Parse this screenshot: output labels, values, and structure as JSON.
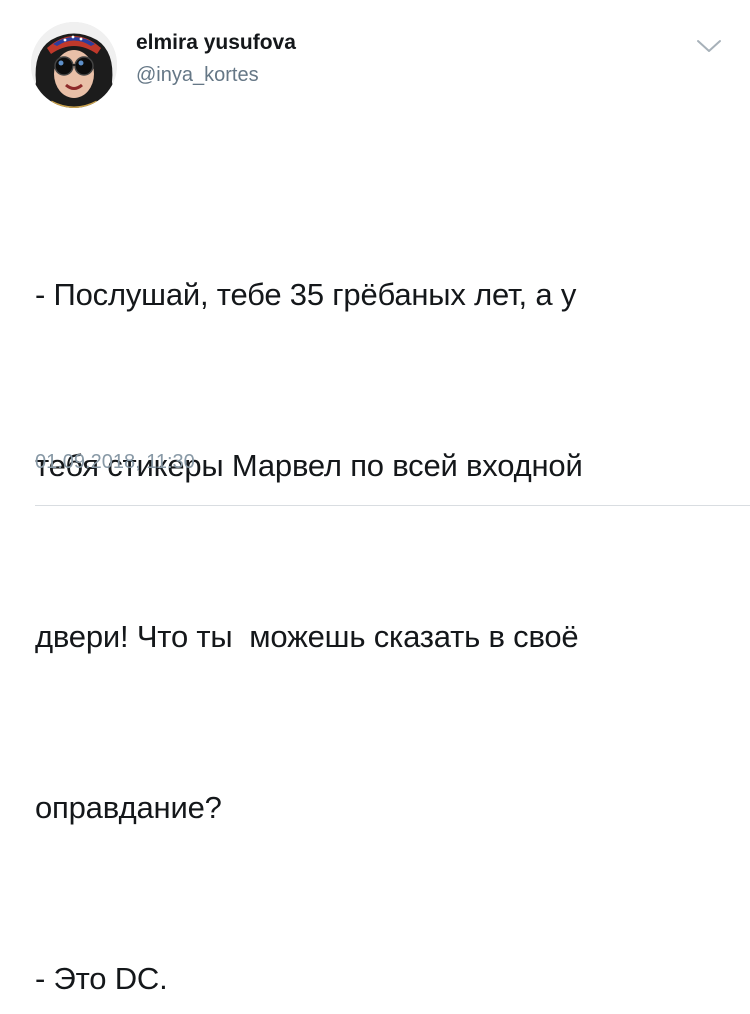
{
  "tweet": {
    "author_name": "elmira yusufova",
    "author_handle": "@inya_kortes",
    "text_lines": [
      "- Послушай, тебе 35 грёбаных лет, а у",
      "тебя стикеры Марвел по всей входной",
      "двери! Что ты  можешь сказать в своё",
      "оправдание?",
      "- Это DC."
    ],
    "timestamp": "01.09.2018, 11:30"
  },
  "icons": {
    "avatar": "profile-photo",
    "caret": "chevron-down-icon"
  },
  "colors": {
    "text": "#14171a",
    "secondary_text": "#657786",
    "timestamp": "#8899a6",
    "divider": "#d9dde1"
  }
}
